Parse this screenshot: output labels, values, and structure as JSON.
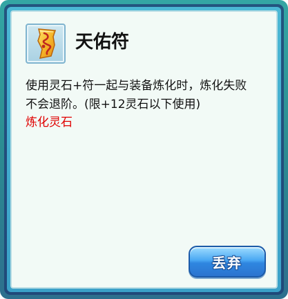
{
  "item": {
    "name": "天佑符",
    "icon": "talisman-icon",
    "description": "使用灵石+符一起与装备炼化时，炼化失败不会退阶。(限+12灵石以下使用)",
    "category_tag": "炼化灵石"
  },
  "actions": {
    "discard_label": "丢弃"
  },
  "colors": {
    "tag_red": "#e00000",
    "frame_teal": "#34a6a4",
    "button_blue": "#2f86e0"
  }
}
